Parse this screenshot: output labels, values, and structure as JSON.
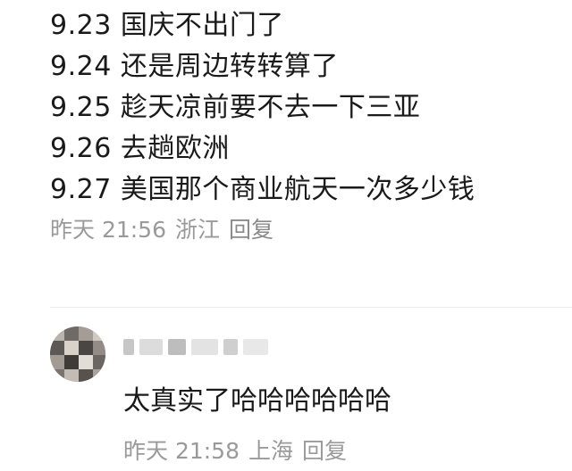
{
  "comment": {
    "lines": [
      "9.23 国庆不出门了",
      "9.24 还是周边转转算了",
      "9.25 趁天凉前要不去一下三亚",
      "9.26 去趟欧洲",
      "9.27 美国那个商业航天一次多少钱"
    ],
    "time": "昨天 21:56",
    "location": "浙江",
    "reply_label": "回复"
  },
  "reply": {
    "username": "L▪▪▪▪▪",
    "text": "太真实了哈哈哈哈哈哈",
    "time": "昨天 21:58",
    "location": "上海",
    "reply_label": "回复"
  }
}
